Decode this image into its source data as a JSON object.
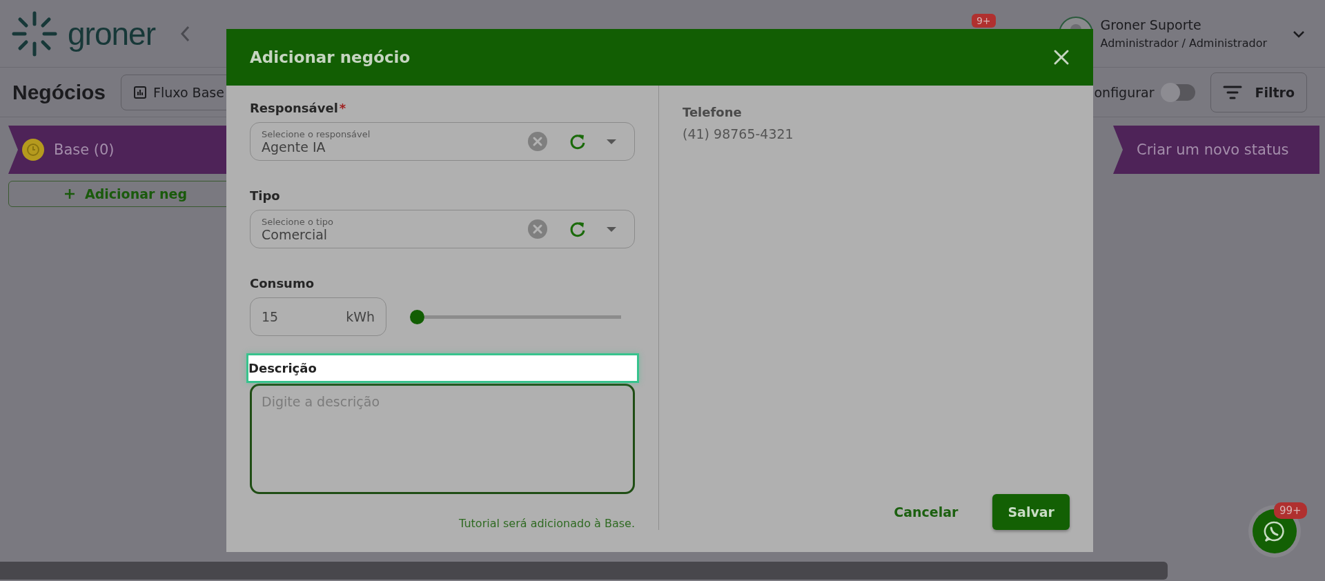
{
  "app": {
    "logo": "groner",
    "notification_badge": "9+",
    "user": {
      "name": "Groner Suporte",
      "role": "Administrador / Administrador"
    }
  },
  "page": {
    "title": "Negócios",
    "flow_button": "Fluxo Base",
    "configure": {
      "label": "onfigurar",
      "on": false
    },
    "filter_button": "Filtro"
  },
  "stages": [
    {
      "kind": "stage",
      "label": "Base (0)"
    },
    {
      "kind": "create",
      "label": "Criar um novo status"
    }
  ],
  "add_button": "Adicionar neg",
  "modal": {
    "title": "Adicionar negócio",
    "fields": [
      {
        "kind": "select",
        "label": "Responsável",
        "required_mark": "*",
        "placeholder": "Selecione o responsável",
        "value": "Agente IA"
      },
      {
        "kind": "select",
        "label": "Tipo",
        "placeholder": "Selecione o tipo",
        "value": "Comercial"
      },
      {
        "kind": "range",
        "label": "Consumo",
        "value": "15",
        "unit": "kWh",
        "level": 0
      },
      {
        "kind": "textarea",
        "label": "Descrição",
        "highlighted": true,
        "placeholder": "Digite a descrição"
      }
    ],
    "note": "Tutorial será adicionado à Base.",
    "details": [
      {
        "label": "Telefone",
        "value": "(41) 98765-4321"
      }
    ],
    "buttons": [
      {
        "kind": "text",
        "label": "Cancelar"
      },
      {
        "kind": "primary",
        "label": "Salvar"
      }
    ]
  },
  "chat_badge": "99+"
}
